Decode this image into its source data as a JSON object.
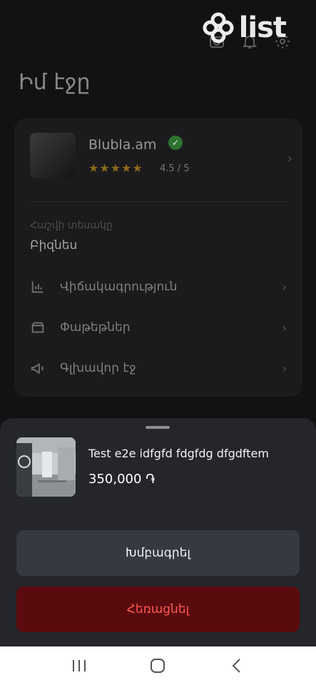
{
  "app": {
    "brand_text": "list"
  },
  "page": {
    "title": "Իմ էջը"
  },
  "card": {
    "shop_name": "Blubla.am",
    "stars": "★★★★★",
    "rating": "4.5 / 5",
    "account_type_label": "Հաշվի տեսակը",
    "account_type_value": "Բիզնես"
  },
  "menu": [
    {
      "label": "Վիճակագրություն",
      "icon": "chart-icon"
    },
    {
      "label": "Փաթեթներ",
      "icon": "package-icon"
    },
    {
      "label": "Գլխավոր էջ",
      "icon": "megaphone-icon"
    }
  ],
  "sheet": {
    "product_title": "Test e2e idfgfd fdgfdg dfgdftem",
    "product_price": "350,000 ֏",
    "edit_label": "Խմբագրել",
    "delete_label": "Հեռացնել"
  },
  "colors": {
    "sheet_bg": "#24262c",
    "edit_bg": "#353942",
    "delete_bg": "#5a0b0e",
    "delete_text": "#ff5a55"
  },
  "navbar": {
    "icons": [
      "recents-icon",
      "home-icon",
      "back-icon"
    ]
  }
}
